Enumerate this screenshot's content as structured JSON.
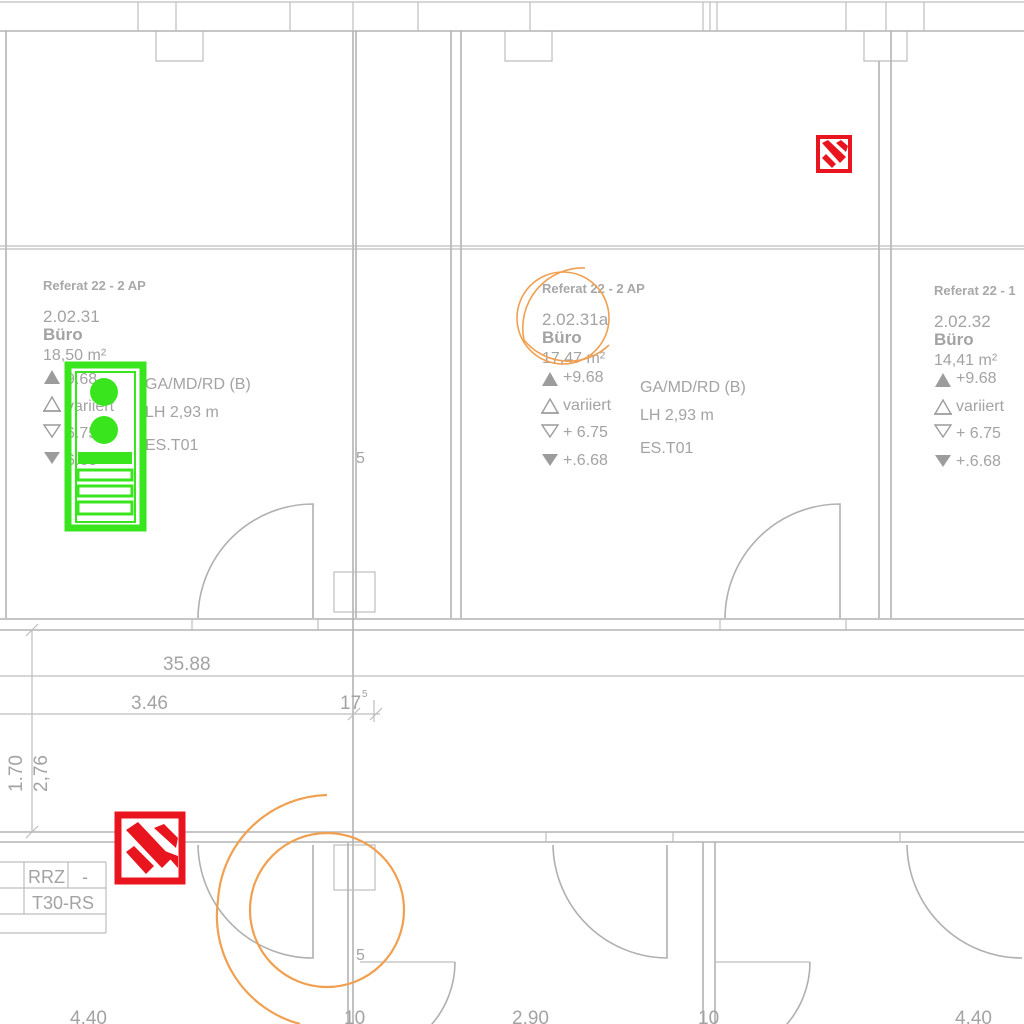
{
  "rooms": [
    {
      "dept": "Referat 22 -  2 AP",
      "number": "2.02.31",
      "name": "Büro",
      "area": "18,50 m²",
      "levels": [
        "9.68",
        "variiert",
        "6.75",
        "6.68"
      ],
      "finish": "GA/MD/RD (B)",
      "height": "LH 2,93 m",
      "code": "ES.T01"
    },
    {
      "dept": "Referat 22 -  2 AP",
      "number": "2.02.31a",
      "name": "Büro",
      "area": "17,47 m²",
      "levels": [
        "+9.68",
        "variiert",
        "+ 6.75",
        "+.6.68"
      ],
      "finish": "GA/MD/RD (B)",
      "height": "LH 2,93 m",
      "code": "ES.T01"
    },
    {
      "dept": "Referat 22 -  1",
      "number": "2.02.32",
      "name": "Büro",
      "area": "14,41 m²",
      "levels": [
        "+9.68",
        "variiert",
        "+ 6.75",
        "+.6.68"
      ]
    }
  ],
  "dimensions": {
    "top_total": "35.88",
    "top_segment": "3.46",
    "top_small": "17",
    "top_small_sup": "5",
    "vert_a": "1.70",
    "vert_b": "2,76",
    "wall_mark_a": "5",
    "wall_mark_b": "5",
    "bottom": [
      "4.40",
      "10",
      "2.90",
      "10",
      "4.40"
    ]
  },
  "tags": {
    "rrz": "RRZ",
    "rrz_dash": "-",
    "t30": "T30-RS"
  },
  "colors": {
    "wall": "#b3b3b3",
    "marker_green": "#39e61e",
    "marker_red": "#e8141e",
    "marker_orange": "#f0a050"
  },
  "icons": [
    "fire-extinguisher-sign-icon",
    "fire-extinguisher-sign-icon",
    "first-aid-cabinet-icon",
    "selection-spiral-icon",
    "selection-spiral-icon"
  ]
}
